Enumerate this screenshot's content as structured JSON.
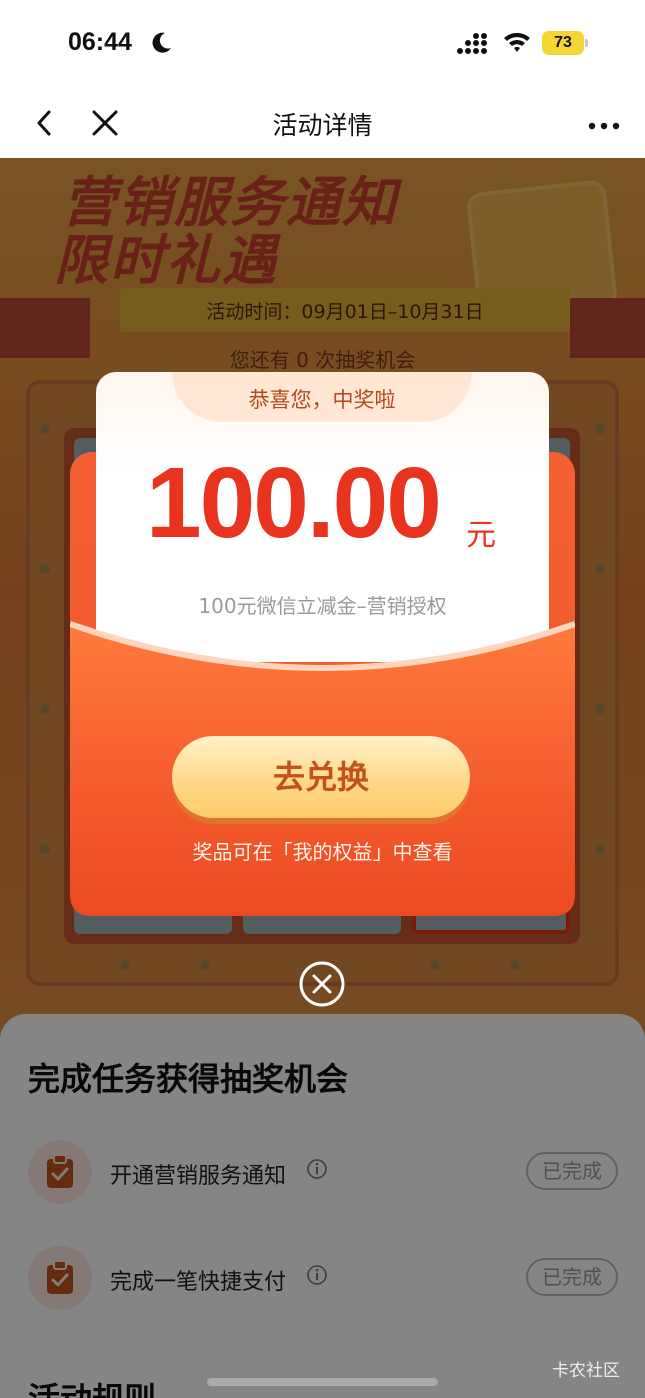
{
  "status_bar": {
    "time": "06:44",
    "battery_level": "73",
    "icons": [
      "moon-icon",
      "signal-icon",
      "wifi-icon",
      "battery-icon"
    ]
  },
  "nav": {
    "title": "活动详情",
    "icons": [
      "back-icon",
      "close-icon",
      "more-icon"
    ]
  },
  "background": {
    "banner_line1": "营销服务通知",
    "banner_line2": "限时礼遇",
    "activity_time": "活动时间：09月01日–10月31日",
    "chances": "您还有 0 次抽奖机会"
  },
  "modal": {
    "header": "恭喜您，中奖啦",
    "amount": "100.00",
    "unit": "元",
    "description": "100元微信立减金–营销授权",
    "redeem_button": "去兑换",
    "hint": "奖品可在「我的权益」中查看"
  },
  "tasks": {
    "heading": "完成任务获得抽奖机会",
    "items": [
      {
        "label": "开通营销服务通知",
        "status": "已完成"
      },
      {
        "label": "完成一笔快捷支付",
        "status": "已完成"
      }
    ],
    "rules_heading": "活动规则"
  },
  "watermark": "卡农社区",
  "colors": {
    "accent": "#e8341e",
    "envelope": "#f25a2c",
    "button": "#ffd98a"
  }
}
